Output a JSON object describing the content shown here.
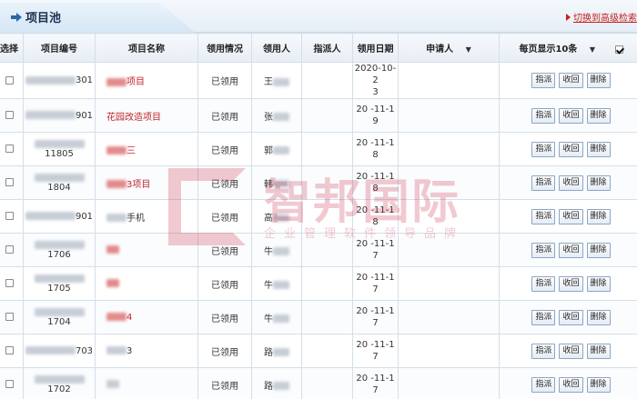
{
  "header": {
    "title": "项目池",
    "switch_link": "切换到高级检索"
  },
  "table": {
    "columns": [
      "选择",
      "项目编号",
      "项目名称",
      "领用情况",
      "领用人",
      "指派人",
      "领用日期",
      "申请人",
      "每页显示10条"
    ],
    "applicant_dropdown": "▼",
    "page_size_dropdown": "▼",
    "actions": {
      "assign": "指派",
      "recall": "收回",
      "delete": "删除"
    },
    "rows": [
      {
        "id": "301",
        "name": "项目",
        "name_red": true,
        "status": "已领用",
        "receiver": "王",
        "date_l1": "2020-10-2",
        "date_l2": "3"
      },
      {
        "id": "901",
        "name": "花园改造项目",
        "name_red": true,
        "status": "已领用",
        "receiver": "张",
        "date_l1": "20  -11-1",
        "date_l2": "9"
      },
      {
        "id": "11805",
        "name": "三",
        "name_red": true,
        "status": "已领用",
        "receiver": "郭",
        "date_l1": "20  -11-1",
        "date_l2": "8"
      },
      {
        "id": "1804",
        "name": "3项目",
        "name_red": true,
        "status": "已领用",
        "receiver": "韩",
        "date_l1": "20  -11-1",
        "date_l2": "8"
      },
      {
        "id": "901",
        "name": "手机",
        "name_red": false,
        "status": "已领用",
        "receiver": "高",
        "date_l1": "20  -11-1",
        "date_l2": "8"
      },
      {
        "id": "1706",
        "name": "",
        "name_red": true,
        "status": "已领用",
        "receiver": "牛",
        "date_l1": "20  -11-1",
        "date_l2": "7"
      },
      {
        "id": "1705",
        "name": "",
        "name_red": true,
        "status": "已领用",
        "receiver": "牛",
        "date_l1": "20  -11-1",
        "date_l2": "7"
      },
      {
        "id": "1704",
        "name": "4",
        "name_red": true,
        "status": "已领用",
        "receiver": "牛",
        "date_l1": "20  -11-1",
        "date_l2": "7"
      },
      {
        "id": "703",
        "name": "3",
        "name_red": false,
        "status": "已领用",
        "receiver": "路",
        "date_l1": "20  -11-1",
        "date_l2": "7"
      },
      {
        "id": "1702",
        "name": "",
        "name_red": false,
        "status": "已领用",
        "receiver": "路",
        "date_l1": "20  -11-1",
        "date_l2": "7"
      }
    ]
  },
  "watermark": {
    "text": "智邦国际",
    "subtext": "企业管理软件领导品牌"
  }
}
